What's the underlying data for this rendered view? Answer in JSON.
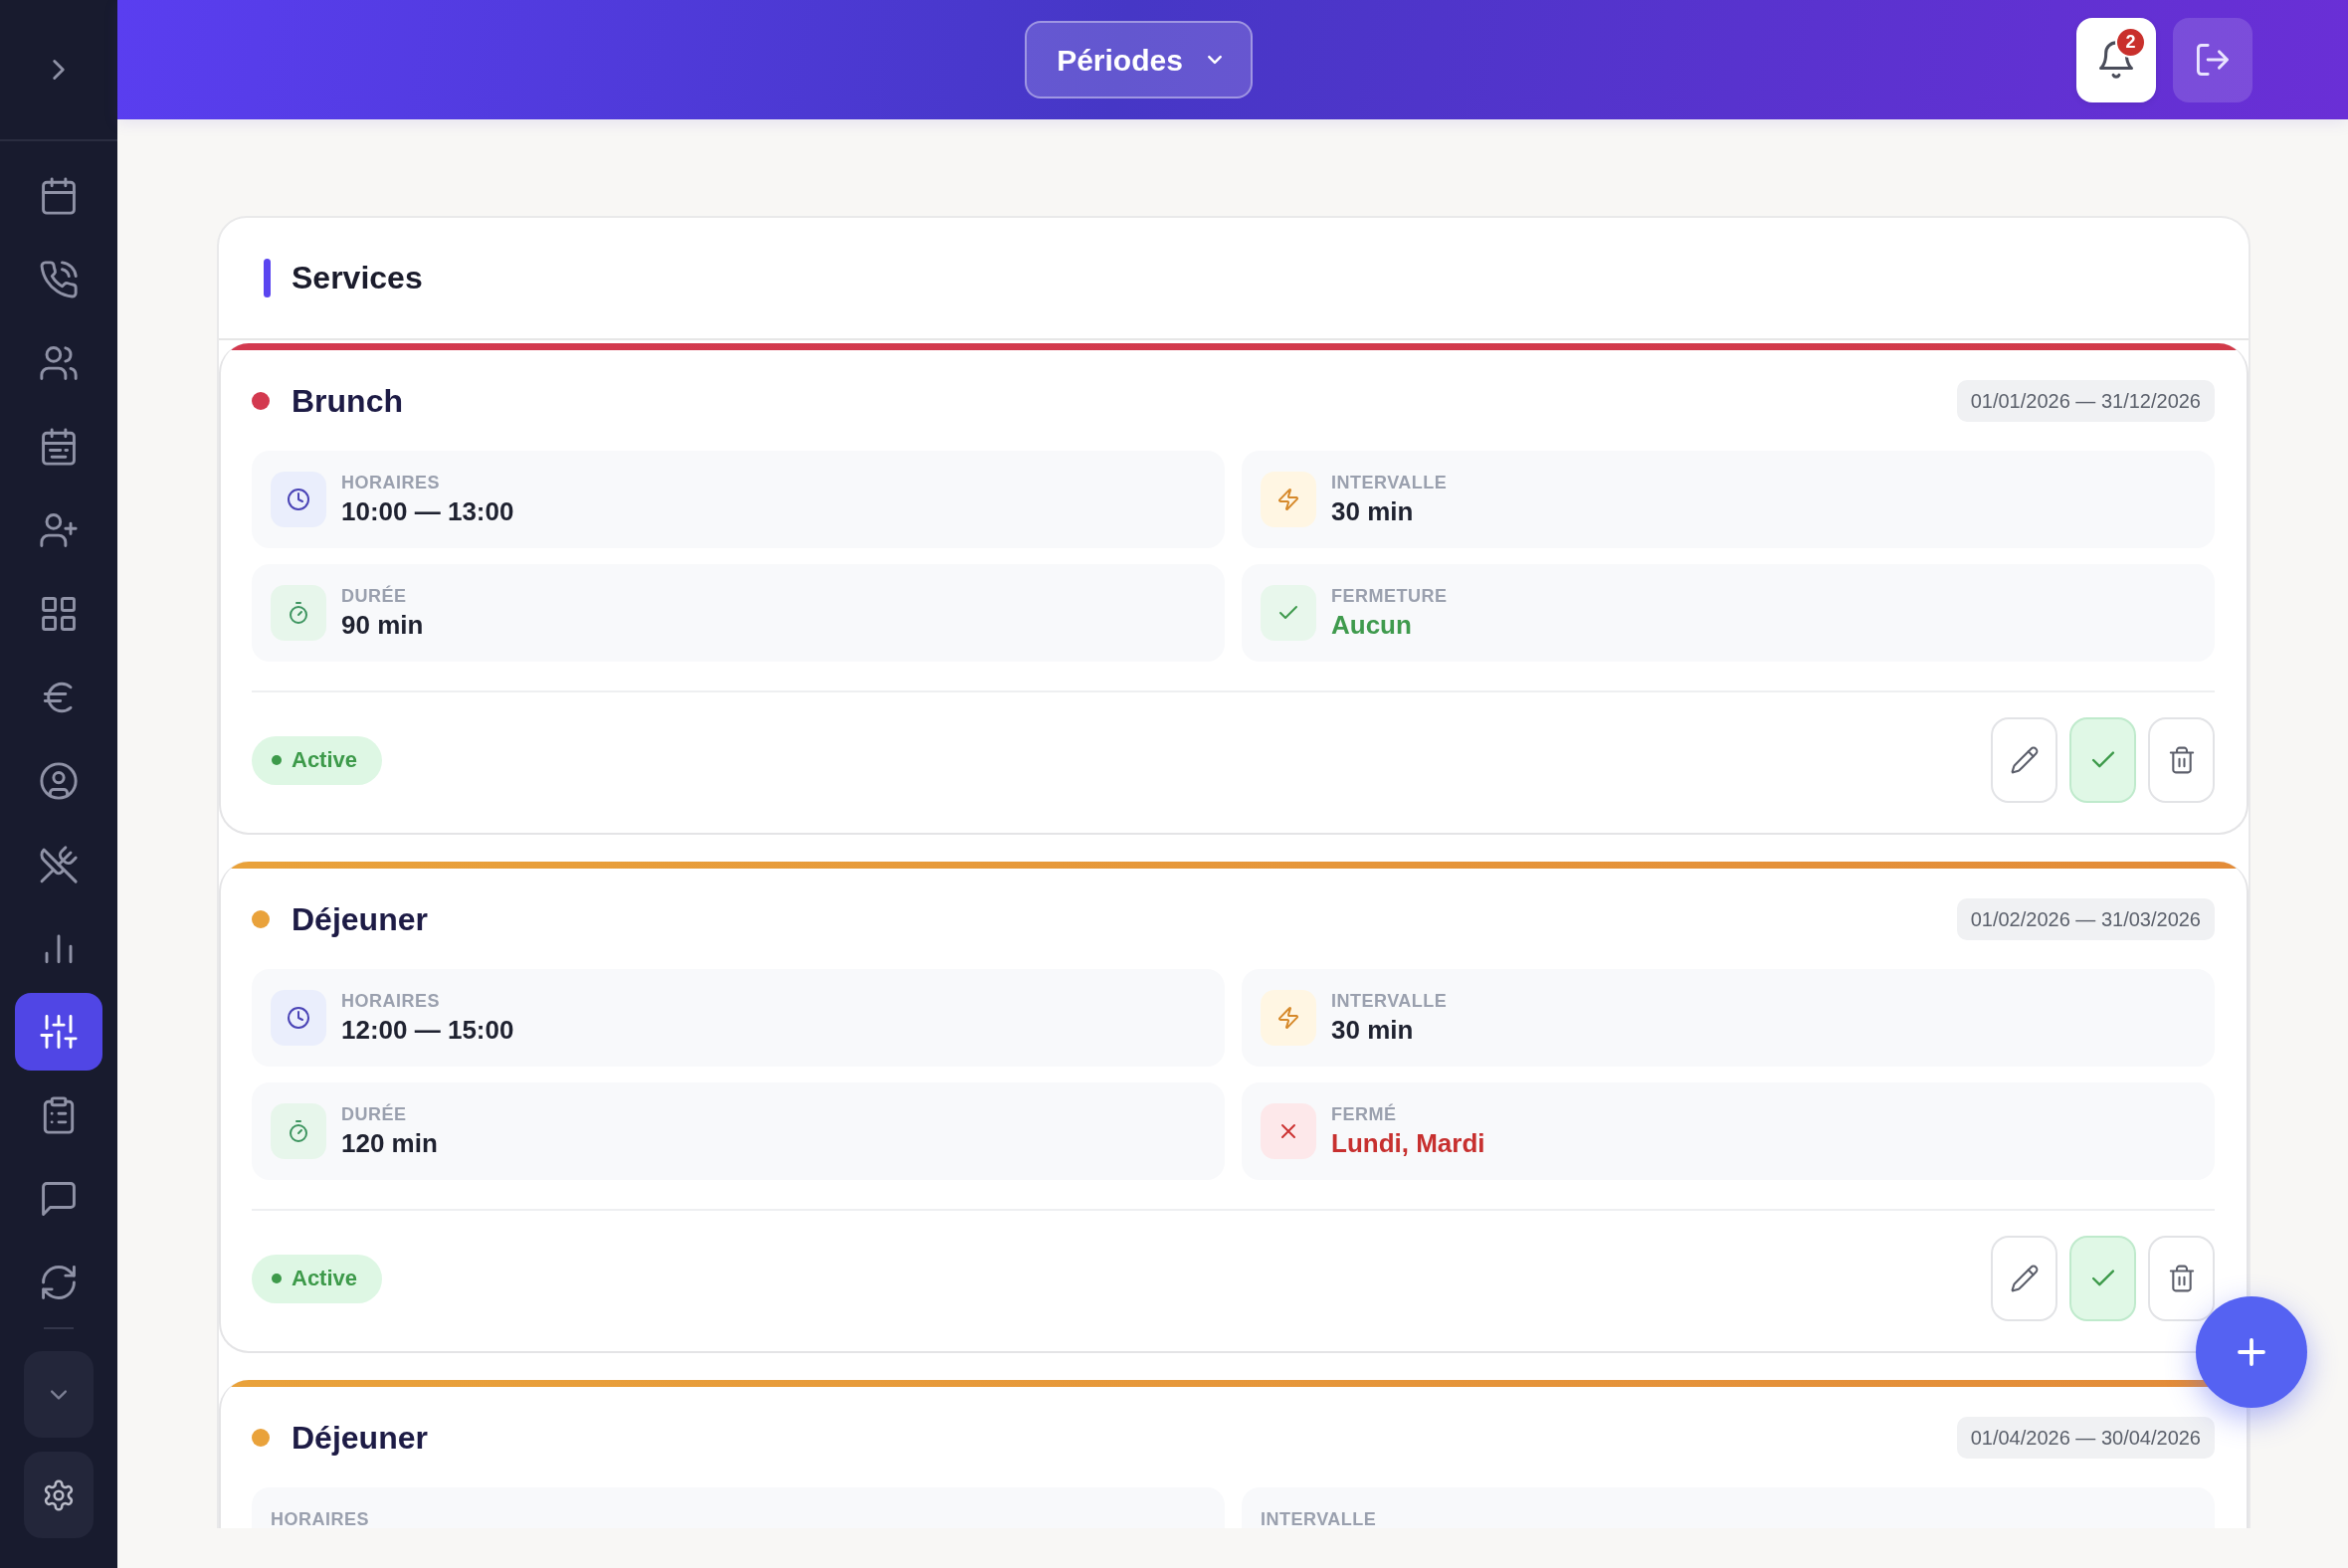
{
  "sidebar": {
    "items": [
      {
        "selected": false
      },
      {
        "selected": false
      },
      {
        "selected": false
      },
      {
        "selected": false
      },
      {
        "selected": false
      },
      {
        "selected": false
      },
      {
        "selected": false
      },
      {
        "selected": false
      },
      {
        "selected": false
      },
      {
        "selected": false
      },
      {
        "selected": true
      },
      {
        "selected": false
      },
      {
        "selected": false
      },
      {
        "selected": false
      }
    ]
  },
  "header": {
    "period_menu": {
      "label": "Périodes"
    },
    "notifications": {
      "count": "2"
    }
  },
  "panel": {
    "title": "Services",
    "services": [
      {
        "name": "Brunch",
        "color": "#d3394f",
        "dates": "01/01/2026 — 31/12/2026",
        "details": [
          {
            "kind": "schedule",
            "label": "HORAIRES",
            "value": "10:00 — 13:00"
          },
          {
            "kind": "interval",
            "label": "INTERVALLE",
            "value": "30 min"
          },
          {
            "kind": "duration",
            "label": "DURÉE",
            "value": "90 min"
          },
          {
            "kind": "closure",
            "closed": false,
            "label": "FERMETURE",
            "value": "Aucun"
          }
        ],
        "status": {
          "label": "Active",
          "active": true
        }
      },
      {
        "name": "Déjeuner",
        "color": "#e9a23b",
        "dates": "01/02/2026 — 31/03/2026",
        "details": [
          {
            "kind": "schedule",
            "label": "HORAIRES",
            "value": "12:00 — 15:00"
          },
          {
            "kind": "interval",
            "label": "INTERVALLE",
            "value": "30 min"
          },
          {
            "kind": "duration",
            "label": "DURÉE",
            "value": "120 min"
          },
          {
            "kind": "closure",
            "closed": true,
            "label": "FERMÉ",
            "value": "Lundi, Mardi"
          }
        ],
        "status": {
          "label": "Active",
          "active": true
        }
      },
      {
        "name": "Déjeuner",
        "color": "#e9a23b",
        "dates": "01/04/2026 — 30/04/2026",
        "details": [
          {
            "label": "HORAIRES"
          },
          {
            "label": "INTERVALLE"
          }
        ]
      }
    ]
  }
}
